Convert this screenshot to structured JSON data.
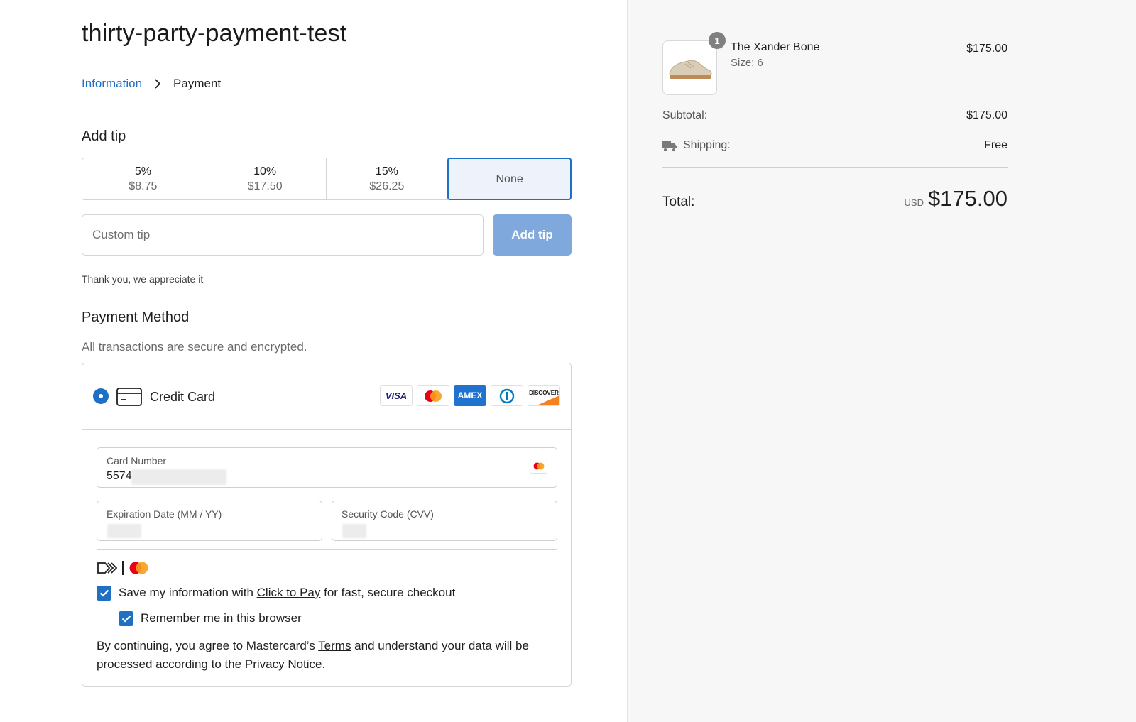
{
  "store": {
    "title": "thirty-party-payment-test"
  },
  "breadcrumb": {
    "step1": "Information",
    "step2": "Payment"
  },
  "tip": {
    "heading": "Add tip",
    "options": [
      {
        "percent": "5%",
        "amount": "$8.75"
      },
      {
        "percent": "10%",
        "amount": "$17.50"
      },
      {
        "percent": "15%",
        "amount": "$26.25"
      },
      {
        "label": "None"
      }
    ],
    "selected": "None",
    "custom_placeholder": "Custom tip",
    "add_button": "Add tip",
    "thanks": "Thank you, we appreciate it"
  },
  "payment": {
    "heading": "Payment Method",
    "subheading": "All transactions are secure and encrypted.",
    "method_label": "Credit Card",
    "brands": [
      "VISA",
      "Mastercard",
      "AMEX",
      "Diners Club",
      "DISCOVER"
    ],
    "card_number_label": "Card Number",
    "card_number_value": "5574",
    "expiry_label": "Expiration Date (MM / YY)",
    "cvv_label": "Security Code (CVV)",
    "save_info_prefix": "Save my information with ",
    "save_info_link": "Click to Pay",
    "save_info_suffix": " for fast, secure checkout",
    "remember_label": "Remember me in this browser",
    "terms_prefix": "By continuing, you agree to Mastercard’s ",
    "terms_link": "Terms",
    "terms_middle": " and understand your data will be processed according to the ",
    "privacy_link": "Privacy Notice",
    "terms_suffix": "."
  },
  "summary": {
    "item": {
      "name": "The Xander Bone",
      "size": "Size: 6",
      "price": "$175.00",
      "quantity": "1"
    },
    "subtotal_label": "Subtotal:",
    "subtotal_value": "$175.00",
    "shipping_label": "Shipping:",
    "shipping_value": "Free",
    "total_label": "Total:",
    "currency": "USD",
    "total_value": "$175.00"
  },
  "colors": {
    "accent": "#1f6fc5",
    "button_disabled": "#7fa8dc",
    "sidebar_bg": "#f7f7f7"
  }
}
